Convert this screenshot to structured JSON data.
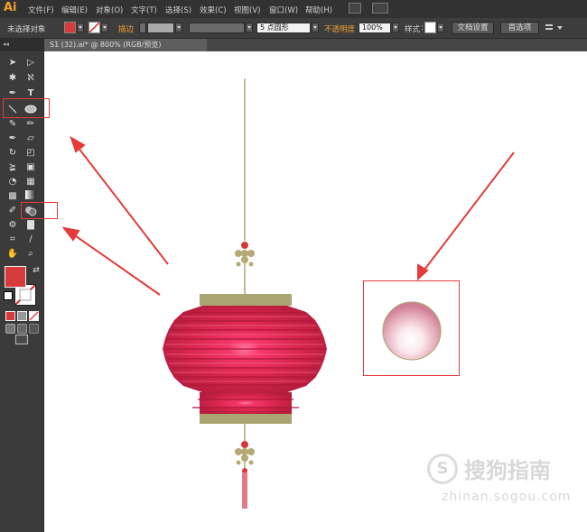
{
  "app": {
    "logo": "Ai"
  },
  "menu": [
    "文件(F)",
    "编辑(E)",
    "对象(O)",
    "文字(T)",
    "选择(S)",
    "效果(C)",
    "视图(V)",
    "窗口(W)",
    "帮助(H)"
  ],
  "control_bar": {
    "selection_status": "未选择对象",
    "stroke_label": "描边",
    "brush_value": "5 点圆形",
    "opacity_label": "不透明度",
    "opacity_value": "100%",
    "style_label": "样式",
    "doc_setup_button": "文档设置",
    "preferences_button": "首选项",
    "fill_color": "#d63b3b",
    "stroke_color": "#ffffff"
  },
  "document_tab": {
    "title": "S1 (32).ai* @ 800% (RGB/预览)"
  },
  "toolbox": {
    "collapse_label": "◂◂",
    "fill_color": "#d63b3b",
    "stroke_color": "#ffffff"
  },
  "watermark": {
    "brand": "搜狗指南",
    "url": "zhinan.sogou.com"
  },
  "colors": {
    "annotation_red": "#e53b3b",
    "lantern_red": "#d42648",
    "lantern_highlight": "#ff6b93",
    "lantern_gold": "#a8a273"
  }
}
